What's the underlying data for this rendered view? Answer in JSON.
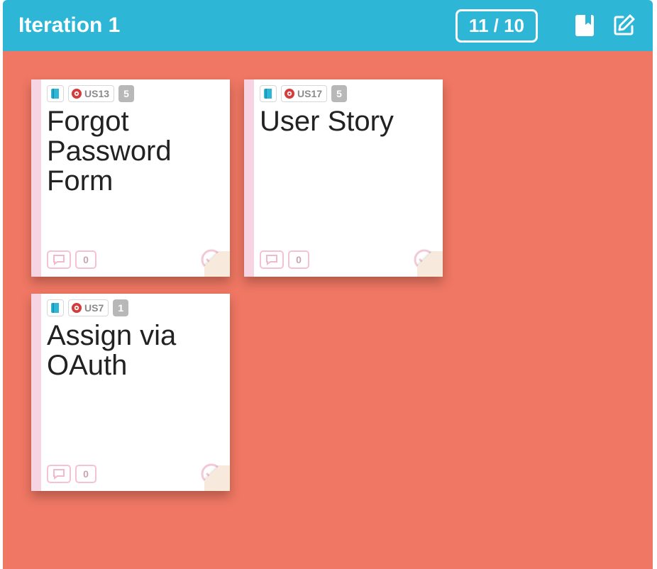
{
  "header": {
    "title": "Iteration 1",
    "points_current": 11,
    "points_total": 10,
    "points_display": "11 / 10"
  },
  "cards": [
    {
      "id": "US13",
      "points": "5",
      "title": "Forgot Password Form",
      "tasks": "0"
    },
    {
      "id": "US17",
      "points": "5",
      "title": "User Story",
      "tasks": "0"
    },
    {
      "id": "US7",
      "points": "1",
      "title": "Assign via OAuth",
      "tasks": "0"
    }
  ],
  "colors": {
    "header": "#2eb6d6",
    "board": "#ef7763",
    "card_edge": "#f7d4e1",
    "story_dot": "#d63a3a"
  }
}
